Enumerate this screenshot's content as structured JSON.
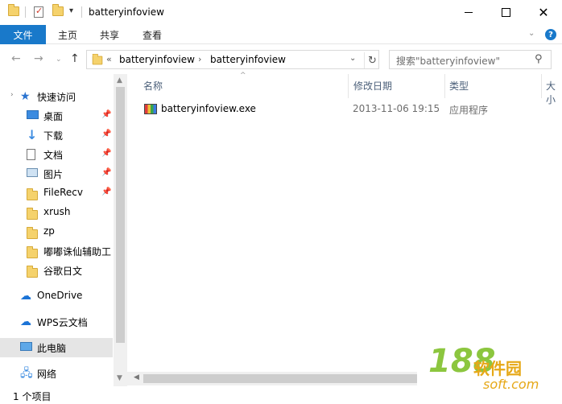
{
  "window": {
    "title": "batteryinfoview",
    "quick_access_dropdown": "▾"
  },
  "ribbon": {
    "tabs": [
      "文件",
      "主页",
      "共享",
      "查看"
    ],
    "help": "?"
  },
  "address": {
    "overflow": "«",
    "crumbs": [
      "batteryinfoview",
      "batteryinfoview"
    ],
    "separator": "›"
  },
  "search": {
    "placeholder": "搜索\"batteryinfoview\""
  },
  "navigation": {
    "quick_access": "快速访问",
    "items": [
      {
        "label": "桌面",
        "icon": "desktop-icon",
        "pinned": true
      },
      {
        "label": "下载",
        "icon": "download-icon",
        "pinned": true
      },
      {
        "label": "文档",
        "icon": "document-icon",
        "pinned": true
      },
      {
        "label": "图片",
        "icon": "pictures-icon",
        "pinned": true
      },
      {
        "label": "FileRecv",
        "icon": "folder-icon",
        "pinned": true
      },
      {
        "label": "xrush",
        "icon": "folder-icon",
        "pinned": false
      },
      {
        "label": "zp",
        "icon": "folder-icon",
        "pinned": false
      },
      {
        "label": "嘟嘟诛仙辅助工",
        "icon": "folder-icon",
        "pinned": false
      },
      {
        "label": "谷歌日文",
        "icon": "folder-icon",
        "pinned": false
      }
    ],
    "onedrive": "OneDrive",
    "wps": "WPS云文档",
    "this_pc": "此电脑",
    "network": "网络"
  },
  "columns": [
    "名称",
    "修改日期",
    "类型",
    "大小"
  ],
  "files": [
    {
      "name": "batteryinfoview.exe",
      "modified": "2013-11-06 19:15",
      "type": "应用程序"
    }
  ],
  "status": {
    "count": "1 个项目"
  },
  "watermark": {
    "number": "188",
    "brand": "软件园",
    "url": "soft.com"
  },
  "colors": {
    "accent": "#1979ca",
    "selection": "#e5e5e5",
    "folder": "#f5d26c"
  }
}
